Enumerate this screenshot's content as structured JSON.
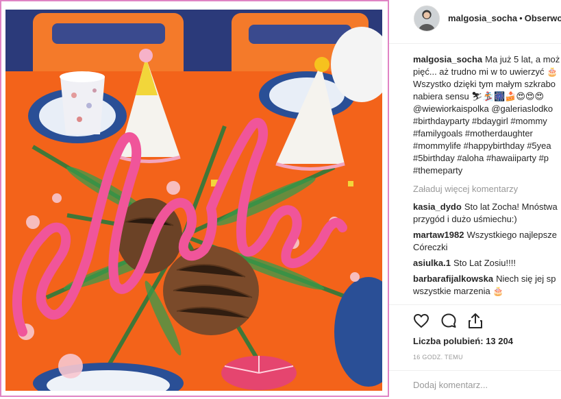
{
  "header": {
    "username": "malgosia_socha",
    "separator": "•",
    "follow_label": "Obserwo"
  },
  "caption": {
    "username": "malgosia_socha",
    "lines": [
      "Ma już 5 lat, a moż",
      "pięć... aż trudno mi w to uwierzyć 🎂",
      "Wszystko dzięki tym małym szkrabo",
      "nabiera sensu ⛷🏂🎆🍰😍😍😍"
    ],
    "mentions": "@wiewiorkaispolka @galeriaslodko",
    "tags": [
      "#birthdayparty #bdaygirl #mommy",
      "#familygoals #motherdaughter",
      "#mommylife #happybirthday #5yea",
      "#5birthday #aloha #hawaiiparty #p",
      "#themeparty"
    ]
  },
  "load_more_label": "Załaduj więcej komentarzy",
  "comments": [
    {
      "user": "kasia_dydo",
      "text": "Sto lat Zocha! Mnóstwa",
      "cont": "przygód i dużo uśmiechu:)"
    },
    {
      "user": "martaw1982",
      "text": "Wszystkiego najlepsze",
      "cont": "Córeczki"
    },
    {
      "user": "asiulka.1",
      "text": "Sto Lat Zosiu!!!!",
      "cont": ""
    },
    {
      "user": "barbarafijalkowska",
      "text": "Niech się jej sp",
      "cont": "wszystkie marzenia 🎂"
    }
  ],
  "likes": {
    "label": "Liczba polubień: 13 204"
  },
  "time_ago": "16 GODZ. TEMU",
  "add_comment": {
    "placeholder": "Dodaj komentarz..."
  },
  "photo": {
    "icons": [
      "like-icon",
      "comment-icon",
      "share-icon"
    ],
    "accent_color": "#e083c4",
    "tablecloth_color": "#f3631a",
    "letters_color": "#f0559a"
  }
}
